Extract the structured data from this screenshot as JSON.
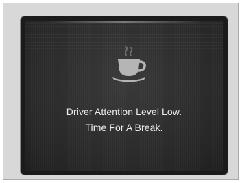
{
  "display": {
    "icon": "coffee-cup-icon",
    "message_line_1": "Driver Attention Level Low.",
    "message_line_2": "Time For A Break."
  },
  "colors": {
    "screen_background": "#2e2e2e",
    "text": "#ececec",
    "icon": "#b5b5b5"
  }
}
